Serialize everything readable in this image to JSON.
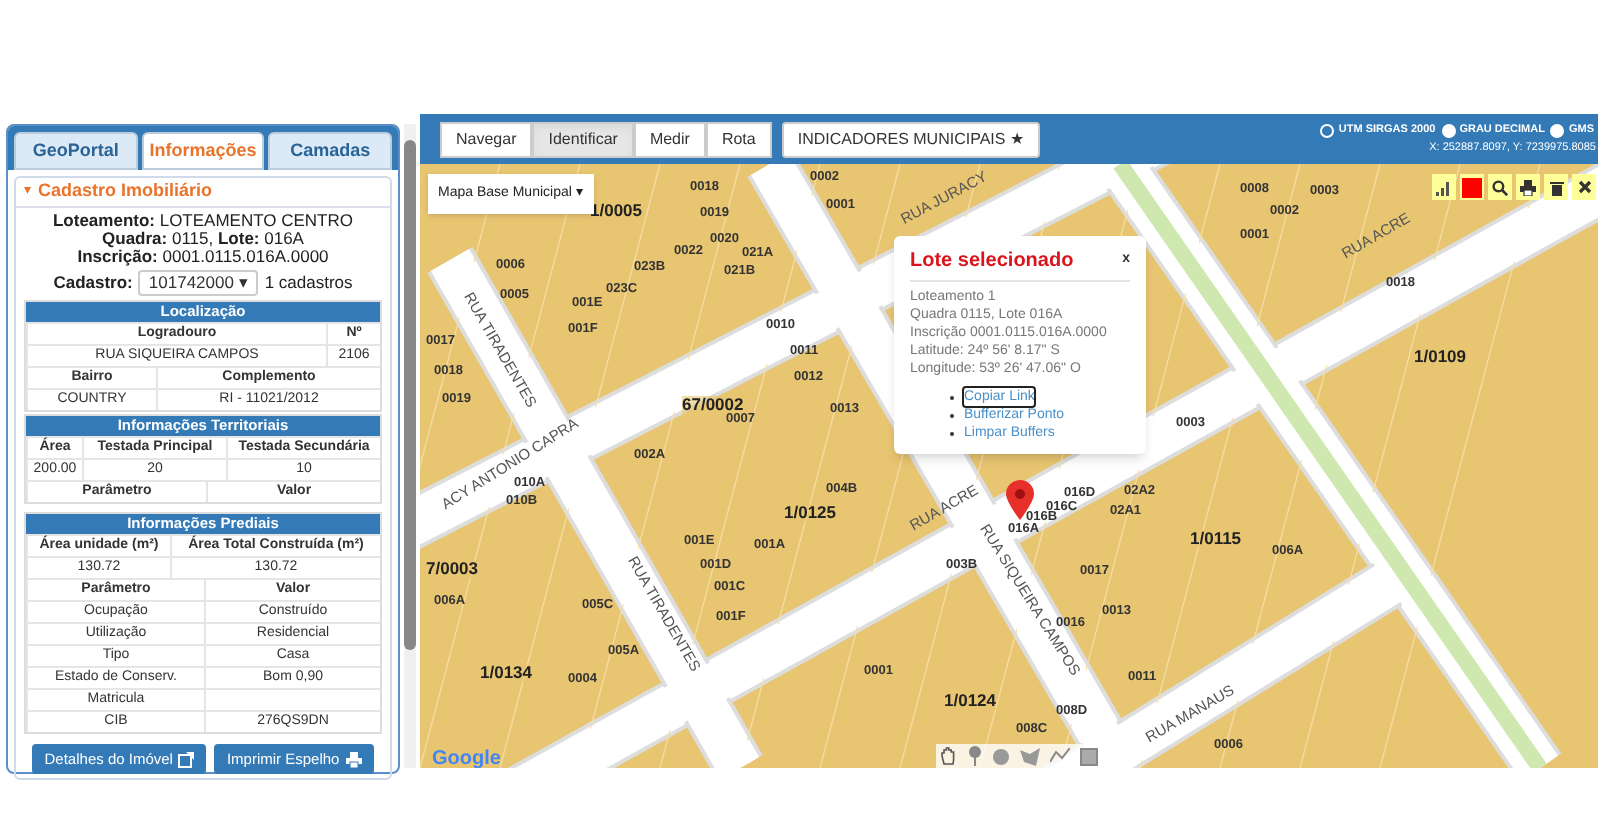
{
  "panel": {
    "tabs": [
      {
        "label": "GeoPortal",
        "selected": false
      },
      {
        "label": "Informações",
        "selected": true
      },
      {
        "label": "Camadas",
        "selected": false
      }
    ],
    "section": {
      "caret": "▾",
      "title": "Cadastro Imobiliário",
      "expanded": true
    },
    "summary": [
      "**Loteamento:** LOTEAMENTO CENTRO",
      "**Quadra:** 0115, **Lote:** 016A",
      "**Inscrição:** 0001.0115.016A.0000"
    ],
    "cadastro": {
      "label": "Cadastro:",
      "value": "101742000",
      "caret": "▾",
      "count": "1 cadastros"
    },
    "localizacao": {
      "title": "Localização",
      "rows": [
        [
          "Logradouro",
          "Nº"
        ],
        [
          "RUA SIQUEIRA CAMPOS",
          "2106"
        ]
      ],
      "rows2": [
        [
          "Bairro",
          "Complemento"
        ],
        [
          "COUNTRY",
          "RI - 11021/2012"
        ]
      ]
    },
    "territoriais": {
      "title": "Informações Territoriais",
      "rows": [
        [
          "Área",
          "Testada Principal",
          "Testada Secundária"
        ],
        [
          "200.00",
          "20",
          "10"
        ]
      ],
      "param": [
        "Parâmetro",
        "Valor"
      ]
    },
    "prediais": {
      "title": "Informações Prediais",
      "head": [
        [
          "Área unidade (m²)",
          "Área Total Construída (m²)"
        ],
        [
          "130.72",
          "130.72"
        ]
      ],
      "param": [
        "Parâmetro",
        "Valor"
      ],
      "rows": [
        [
          "Ocupação",
          "Construído"
        ],
        [
          "Utilização",
          "Residencial"
        ],
        [
          "Tipo",
          "Casa"
        ],
        [
          "Estado de Conserv.",
          "Bom 0,90"
        ],
        [
          "Matricula",
          ""
        ],
        [
          "CIB",
          "276QS9DN"
        ]
      ]
    },
    "buttons": [
      "Detalhes do Imóvel",
      "Imprimir Espelho"
    ]
  },
  "map": {
    "toolbar": [
      {
        "label": "Navegar",
        "selected": false
      },
      {
        "label": "Identificar",
        "selected": true
      },
      {
        "label": "Medir",
        "selected": false
      },
      {
        "label": "Rota",
        "selected": false
      }
    ],
    "indicadores": {
      "label": "INDICADORES MUNICIPAIS ★"
    },
    "coord_systems": [
      {
        "label": "UTM SIRGAS 2000",
        "selected": true
      },
      {
        "label": "GRAU DECIMAL",
        "selected": false
      },
      {
        "label": "GMS",
        "selected": false
      }
    ],
    "coordinates": "X: 252887.8097, Y: 7239975.8085",
    "base_layer": {
      "value": "Mapa Base Municipal",
      "caret": "▾"
    },
    "lots": [
      {
        "label": "1/0005",
        "kind": "block"
      },
      {
        "label": "0018",
        "kind": "lot"
      },
      {
        "label": "0019",
        "kind": "lot"
      },
      {
        "label": "0020",
        "kind": "lot"
      },
      {
        "label": "0022",
        "kind": "lot"
      },
      {
        "label": "021A",
        "kind": "lot"
      },
      {
        "label": "023B",
        "kind": "lot"
      },
      {
        "label": "021B",
        "kind": "lot"
      },
      {
        "label": "023C",
        "kind": "lot"
      },
      {
        "label": "001E",
        "kind": "lot"
      },
      {
        "label": "001F",
        "kind": "lot"
      },
      {
        "label": "0006",
        "kind": "lot"
      },
      {
        "label": "0005",
        "kind": "lot"
      },
      {
        "label": "0017",
        "kind": "lot"
      },
      {
        "label": "0018",
        "kind": "lot"
      },
      {
        "label": "0019",
        "kind": "lot"
      },
      {
        "label": "0002",
        "kind": "lot"
      },
      {
        "label": "0001",
        "kind": "lot"
      },
      {
        "label": "0010",
        "kind": "lot"
      },
      {
        "label": "0011",
        "kind": "lot"
      },
      {
        "label": "0012",
        "kind": "lot"
      },
      {
        "label": "67/0002",
        "kind": "block"
      },
      {
        "label": "0007",
        "kind": "lot"
      },
      {
        "label": "0013",
        "kind": "lot"
      },
      {
        "label": "002A",
        "kind": "lot"
      },
      {
        "label": "004B",
        "kind": "lot"
      },
      {
        "label": "1/0125",
        "kind": "block"
      },
      {
        "label": "001E",
        "kind": "lot"
      },
      {
        "label": "001A",
        "kind": "lot"
      },
      {
        "label": "001D",
        "kind": "lot"
      },
      {
        "label": "001C",
        "kind": "lot"
      },
      {
        "label": "001F",
        "kind": "lot"
      },
      {
        "label": "010A",
        "kind": "lot"
      },
      {
        "label": "010B",
        "kind": "lot"
      },
      {
        "label": "7/0003",
        "kind": "block"
      },
      {
        "label": "006A",
        "kind": "lot"
      },
      {
        "label": "005C",
        "kind": "lot"
      },
      {
        "label": "005A",
        "kind": "lot"
      },
      {
        "label": "0004",
        "kind": "lot"
      },
      {
        "label": "1/0134",
        "kind": "block"
      },
      {
        "label": "003B",
        "kind": "lot"
      },
      {
        "label": "0001",
        "kind": "lot"
      },
      {
        "label": "1/0124",
        "kind": "block"
      },
      {
        "label": "016D",
        "kind": "lot"
      },
      {
        "label": "016C",
        "kind": "lot"
      },
      {
        "label": "016B",
        "kind": "lot"
      },
      {
        "label": "016A",
        "kind": "lot"
      },
      {
        "label": "02A2",
        "kind": "lot"
      },
      {
        "label": "02A1",
        "kind": "lot"
      },
      {
        "label": "0016",
        "kind": "lot"
      },
      {
        "label": "0017",
        "kind": "lot"
      },
      {
        "label": "0013",
        "kind": "lot"
      },
      {
        "label": "0011",
        "kind": "lot"
      },
      {
        "label": "008D",
        "kind": "lot"
      },
      {
        "label": "008C",
        "kind": "lot"
      },
      {
        "label": "0008",
        "kind": "lot"
      },
      {
        "label": "0003",
        "kind": "lot"
      },
      {
        "label": "0002",
        "kind": "lot"
      },
      {
        "label": "0001",
        "kind": "lot"
      },
      {
        "label": "0018",
        "kind": "lot"
      },
      {
        "label": "1/0109",
        "kind": "block"
      },
      {
        "label": "0003",
        "kind": "lot"
      },
      {
        "label": "1/0115",
        "kind": "block"
      },
      {
        "label": "006A",
        "kind": "lot"
      },
      {
        "label": "0006",
        "kind": "lot"
      }
    ],
    "streets": [
      "RUA JURACY",
      "RUA ACRE",
      "RUA ACRE",
      "RUA TIRADENTES",
      "RUA TIRADENTES",
      "RUA SIQUEIRA CAMPOS",
      "ACY ANTONIO CAPRA",
      "RUA MANAUS"
    ],
    "popup": {
      "title": "Lote selecionado",
      "close": "x",
      "lines": [
        "Loteamento 1",
        "Quadra 0115, Lote 016A",
        "Inscrição 0001.0115.016A.0000",
        "Latitude: 24º 56' 8.17\" S",
        "Longitude: 53º 26' 47.06\" O"
      ],
      "links": [
        {
          "label": "Copiar Link",
          "focused": true
        },
        {
          "label": "Bufferizar Ponto",
          "focused": false
        },
        {
          "label": "Limpar Buffers",
          "focused": false
        }
      ]
    },
    "attribution": "Google"
  }
}
